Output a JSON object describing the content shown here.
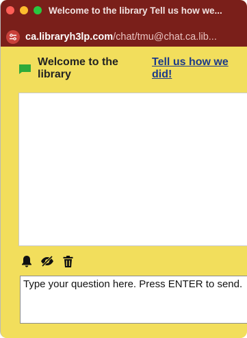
{
  "window": {
    "title": "Welcome to the library Tell us how we..."
  },
  "address_bar": {
    "host": "ca.libraryh3lp.com",
    "path": "/chat/tmu@chat.ca.lib..."
  },
  "header": {
    "welcome": "Welcome to the library",
    "feedback_link": "Tell us how we did!"
  },
  "toolbar": {
    "icons": [
      "bell-icon",
      "eye-slash-icon",
      "trash-icon"
    ]
  },
  "message_input": {
    "placeholder": "Type your question here. Press ENTER to send."
  },
  "colors": {
    "titlebar": "#7a1f1a",
    "panel": "#f2de5c",
    "chat_icon": "#2faa3a",
    "link": "#1b3a8a"
  }
}
